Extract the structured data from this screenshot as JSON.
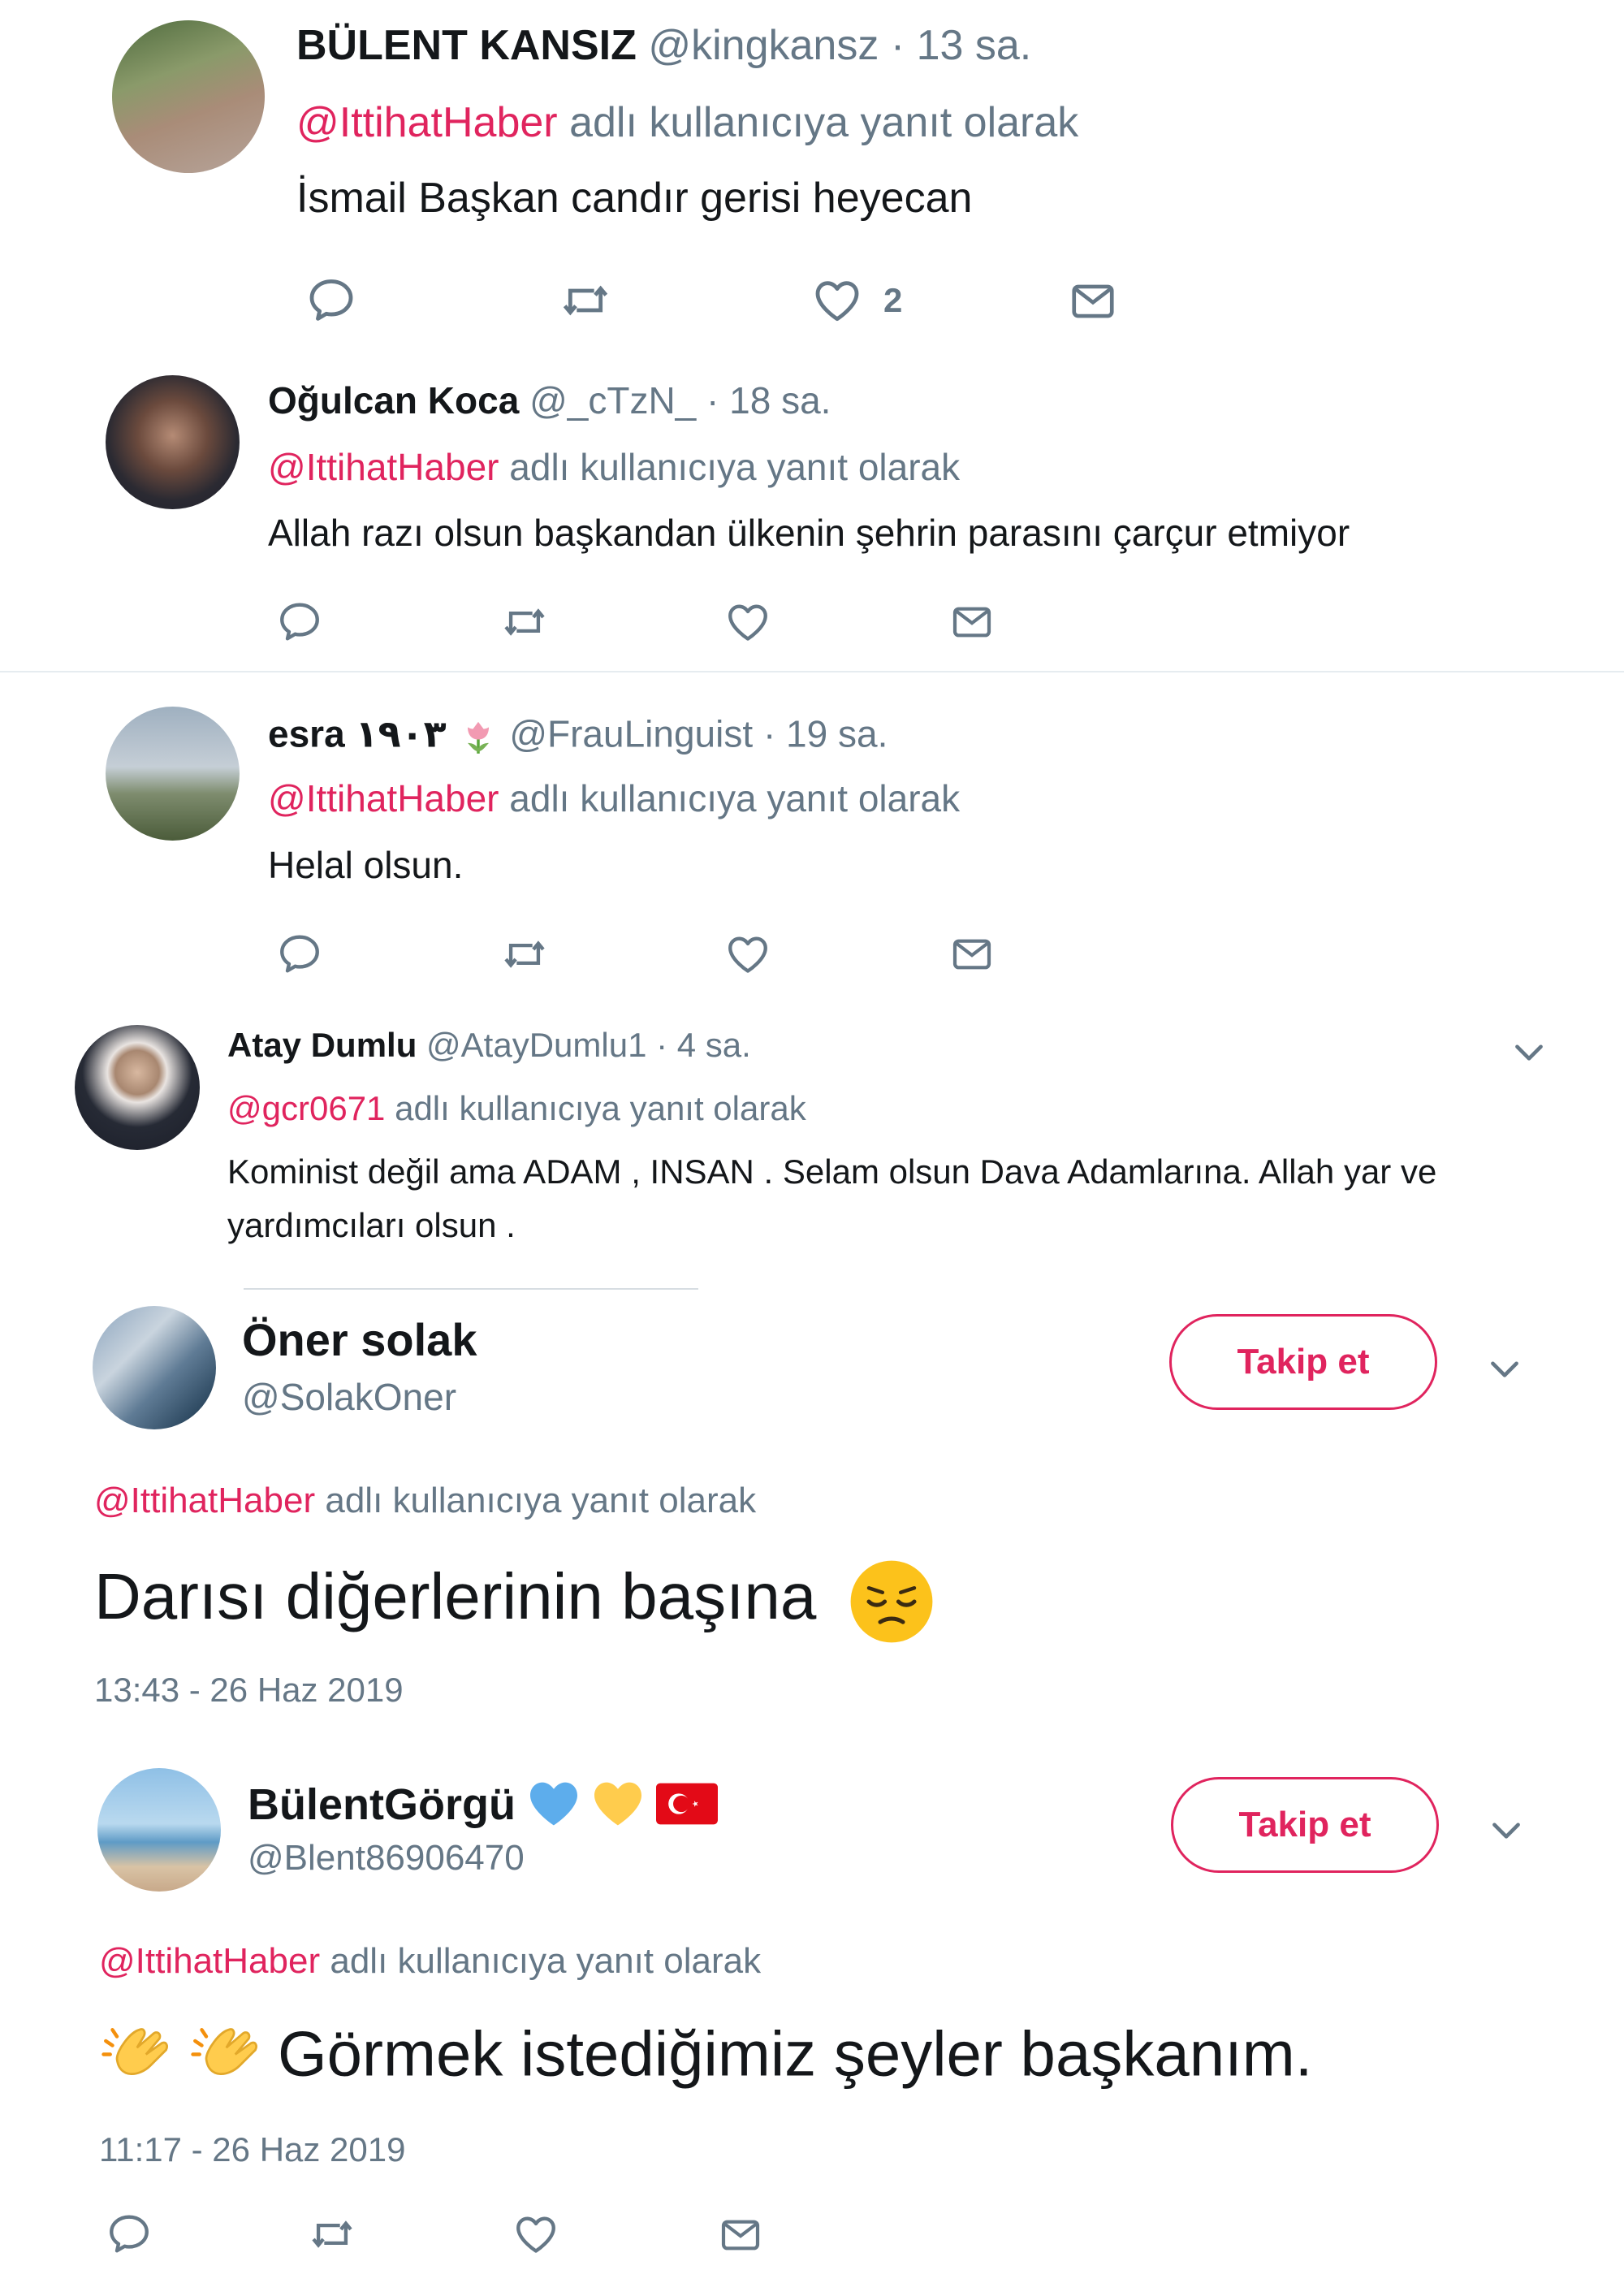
{
  "reply_prefix": "adlı kullanıcıya yanıt olarak",
  "tweets": [
    {
      "display_name": "BÜLENT KANSIZ",
      "handle": "@kingkansz",
      "time": "· 13 sa.",
      "mention": "@IttihatHaber",
      "text": "İsmail Başkan candır gerisi heyecan",
      "like_count": "2"
    },
    {
      "display_name": "Oğulcan Koca",
      "handle": "@_cTzN_",
      "time": "· 18 sa.",
      "mention": "@IttihatHaber",
      "text": "Allah razı olsun başkandan ülkenin şehrin parasını çarçur etmiyor"
    },
    {
      "display_name": "esra ١٩٠٣",
      "handle": "@FrauLinguist",
      "time": "· 19 sa.",
      "mention": "@IttihatHaber",
      "text": "Helal olsun."
    },
    {
      "display_name": "Atay Dumlu",
      "handle": "@AtayDumlu1",
      "time": "· 4 sa.",
      "mention": "@gcr0671",
      "text_line1": "Kominist değil ama ADAM , INSAN . Selam olsun Dava Adamlarına.  Allah yar ve",
      "text_line2": "yardımcıları olsun ."
    },
    {
      "display_name": "Öner solak",
      "handle": "@SolakOner",
      "follow_label": "Takip et",
      "mention": "@IttihatHaber",
      "text": "Darısı diğerlerinin başına",
      "timestamp": "13:43 - 26 Haz 2019"
    },
    {
      "display_name": "BülentGörgü",
      "handle": "@Blent86906470",
      "follow_label": "Takip et",
      "mention": "@IttihatHaber",
      "text": "Görmek istediğimiz şeyler başkanım.",
      "timestamp": "11:17 - 26 Haz 2019"
    }
  ],
  "colors": {
    "accent": "#e0245e",
    "muted": "#657786",
    "text": "#14171a",
    "divider": "#e6ecf0"
  },
  "icons": [
    "reply-icon",
    "retweet-icon",
    "like-icon",
    "dm-icon",
    "chevron-down-icon"
  ]
}
